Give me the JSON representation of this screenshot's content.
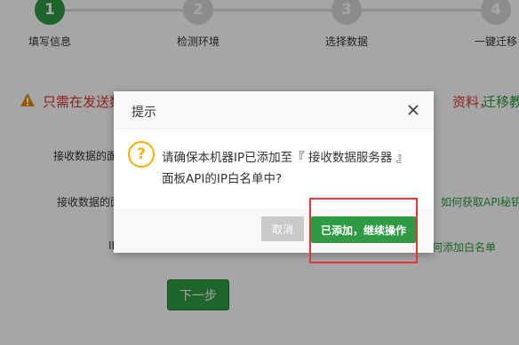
{
  "steps": [
    {
      "num": "1",
      "label": "填写信息",
      "active": true
    },
    {
      "num": "2",
      "label": "检测环境",
      "active": false
    },
    {
      "num": "3",
      "label": "选择数据",
      "active": false
    },
    {
      "num": "4",
      "label": "一键迁移",
      "active": false
    }
  ],
  "warning": {
    "text": "只需在发送数",
    "tail1": "资料，",
    "tail2": "迁移教程"
  },
  "form": {
    "label1": "接收数据的面",
    "label2": "接收数据的面",
    "ip_prefix": "IP",
    "help_api": "如何获取API秘钥",
    "help_whitelist": "何添加白名单",
    "next_label": "下一步"
  },
  "dialog": {
    "title": "提示",
    "icon_text": "?",
    "message": "请确保本机器IP已添加至『 接收数据服务器 』面板API的IP白名单中?",
    "cancel_label": "取消",
    "confirm_label": "已添加，继续操作"
  },
  "colors": {
    "accent": "#2e9b44",
    "warning": "#d9362b",
    "annotation": "#e8333a"
  }
}
